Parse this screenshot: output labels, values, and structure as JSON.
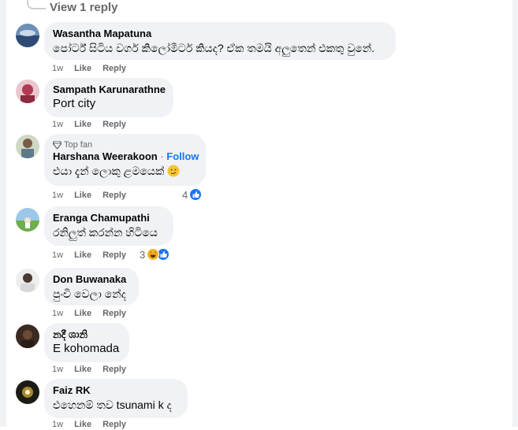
{
  "view_replies_label": "View 1 reply",
  "comments": [
    {
      "author": "Wasantha Mapatuna",
      "text": "පෝර්ට් සිටිය වගර් කිලෝමීටර් කියද? ඒක තමයි අලුතෙන් එකතු වුනේ.",
      "time": "1w",
      "like": "Like",
      "reply": "Reply"
    },
    {
      "author": "Sampath Karunarathne",
      "text": "Port city",
      "time": "1w",
      "like": "Like",
      "reply": "Reply"
    },
    {
      "badge": "Top fan",
      "author": "Harshana Weerakoon",
      "follow": "Follow",
      "text": "එයා දැන් ලොකු ළමයෙක්",
      "time": "1w",
      "like": "Like",
      "reply": "Reply",
      "reaction_count": "4"
    },
    {
      "author": "Eranga Chamupathi",
      "text": "රනිලුත් කරන්න හිටියෙ",
      "time": "1w",
      "like": "Like",
      "reply": "Reply",
      "reaction_count": "3"
    },
    {
      "author": "Don Buwanaka",
      "text": "පුංචි වෙලා නේද",
      "time": "1w",
      "like": "Like",
      "reply": "Reply"
    },
    {
      "author": "නදී ශානි",
      "text": "E kohomada",
      "time": "1w",
      "like": "Like",
      "reply": "Reply"
    },
    {
      "author": "Faiz RK",
      "text": "එහෙනම් තව tsunami k ද",
      "time": "1w",
      "like": "Like",
      "reply": "Reply"
    }
  ],
  "colors": {
    "bubble": "#f0f2f5",
    "secondary_text": "#65676b",
    "accent": "#1877f2"
  }
}
